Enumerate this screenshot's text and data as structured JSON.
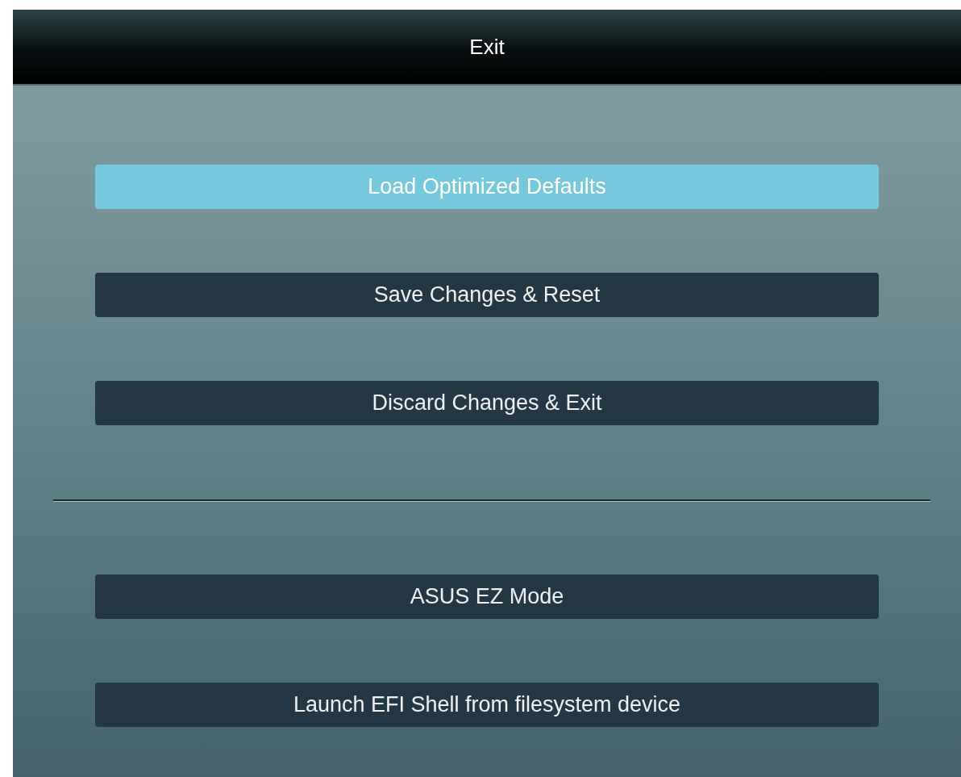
{
  "title": "Exit",
  "groups": [
    {
      "options": [
        {
          "label": "Load Optimized Defaults",
          "selected": true
        },
        {
          "label": "Save Changes & Reset",
          "selected": false
        },
        {
          "label": "Discard Changes & Exit",
          "selected": false
        }
      ]
    },
    {
      "options": [
        {
          "label": "ASUS EZ Mode",
          "selected": false
        },
        {
          "label": "Launch EFI Shell from filesystem device",
          "selected": false
        }
      ]
    }
  ]
}
